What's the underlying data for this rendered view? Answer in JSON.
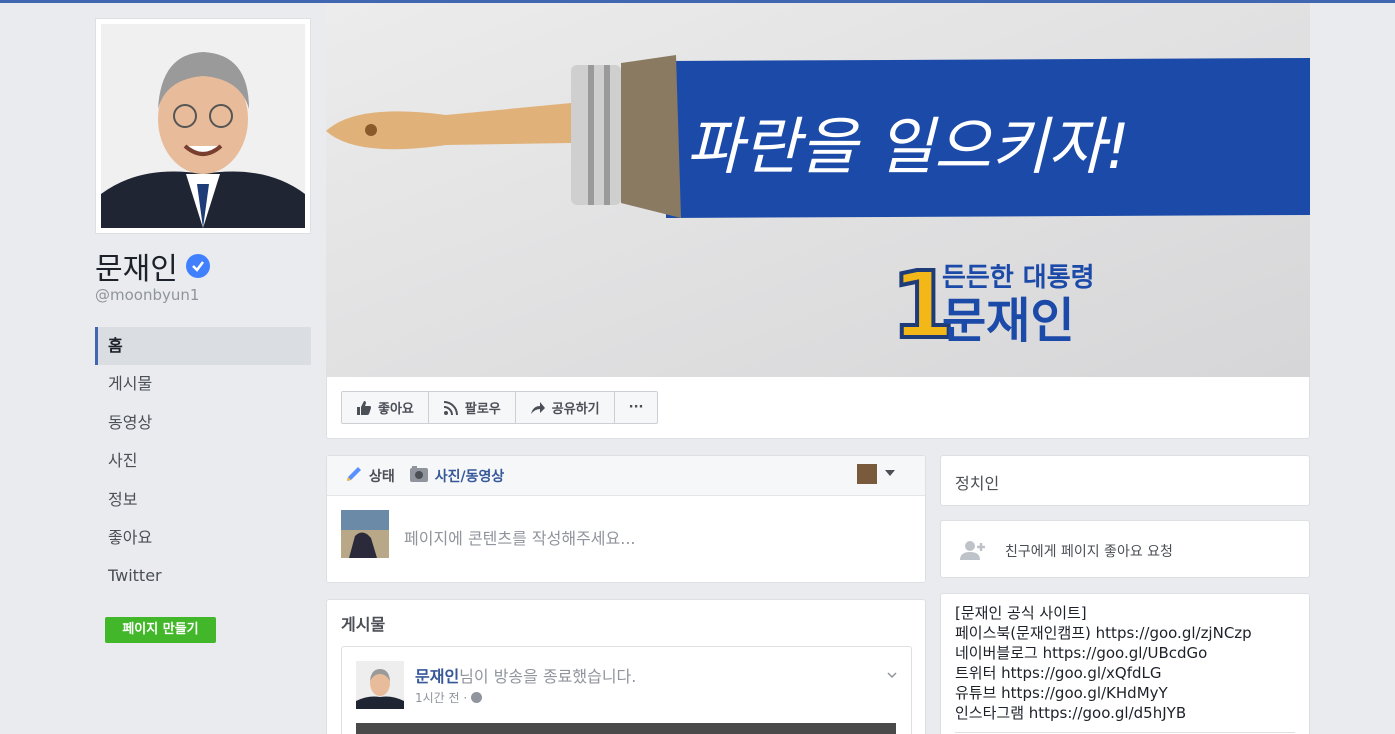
{
  "colors": {
    "brand": "#4267b2",
    "create_button": "#42b72a",
    "link": "#365899",
    "cover_paint": "#1c4aa8"
  },
  "profile": {
    "name": "문재인",
    "username": "@moonbyun1",
    "verified_icon": "verified-check-icon"
  },
  "nav": {
    "items": [
      {
        "label": "홈",
        "active": true
      },
      {
        "label": "게시물"
      },
      {
        "label": "동영상"
      },
      {
        "label": "사진"
      },
      {
        "label": "정보"
      },
      {
        "label": "좋아요"
      },
      {
        "label": "Twitter"
      }
    ]
  },
  "create_page_label": "페이지 만들기",
  "cover": {
    "slogan": "파란을 일으키자!",
    "number": "1",
    "tagline": "든든한 대통령",
    "name": "문재인"
  },
  "actions": {
    "like": "좋아요",
    "follow": "팔로우",
    "share": "공유하기",
    "more": "···"
  },
  "composer": {
    "status_tab": "상태",
    "photo_tab": "사진/동영상",
    "placeholder": "페이지에 콘텐츠를 작성해주세요..."
  },
  "posts": {
    "title": "게시물",
    "first": {
      "author": "문재인",
      "action": "님이 방송을 종료했습니다.",
      "time": "1시간 전 ·"
    }
  },
  "sidebar": {
    "category": "정치인",
    "invite": "친구에게 페이지 좋아요 요청",
    "about_lines": [
      "[문재인 공식 사이트]",
      "페이스북(문재인캠프) https://goo.gl/zjNCzp",
      "네이버블로그 https://goo.gl/UBcdGo",
      "트위터 https://goo.gl/xQfdLG",
      "유튜브 https://goo.gl/KHdMyY",
      "인스타그램 https://goo.gl/d5hJYB"
    ]
  }
}
